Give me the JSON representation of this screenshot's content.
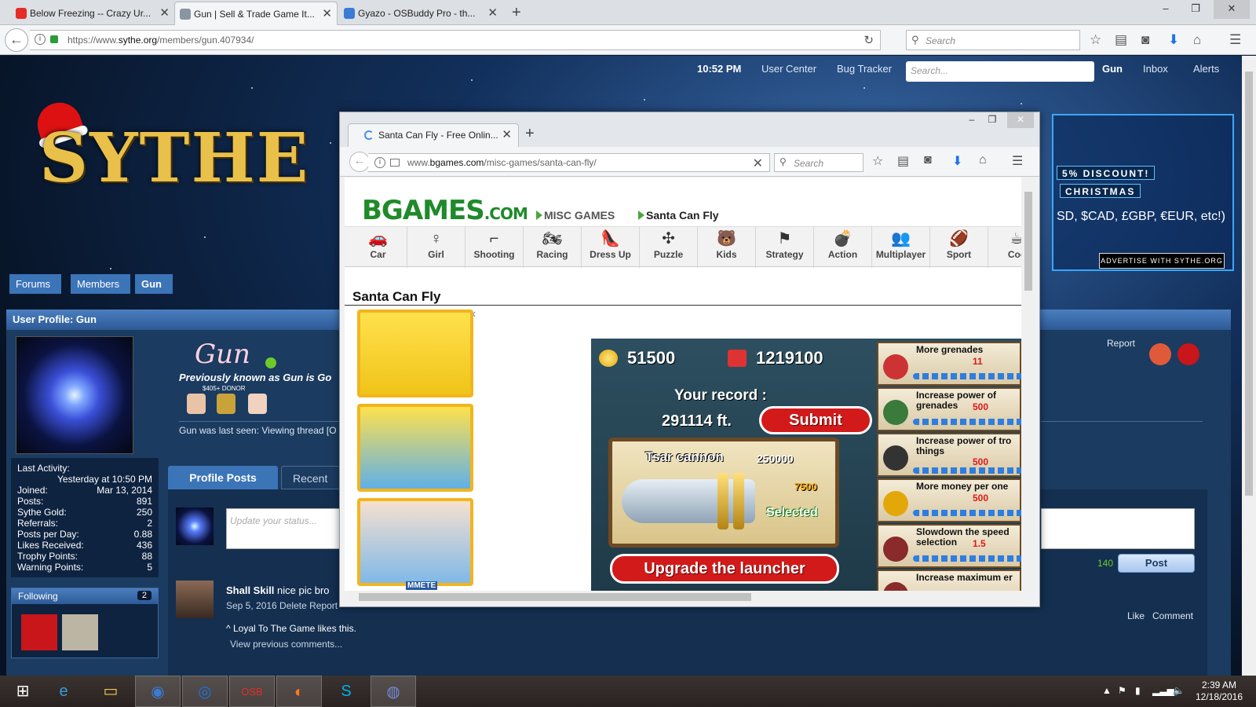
{
  "browser": {
    "tabs": [
      {
        "title": "Below Freezing -- Crazy Ur...",
        "favicon_color": "#e52d27"
      },
      {
        "title": "Gun | Sell & Trade Game It...",
        "favicon_color": "#8a95a3"
      },
      {
        "title": "Gyazo - OSBuddy Pro - th...",
        "favicon_color": "#3a7bd5"
      }
    ],
    "new_tab": "+",
    "url_prefix": "https://www.",
    "url_domain": "sythe.org",
    "url_path": "/members/gun.407934/",
    "search_placeholder": "Search",
    "win_min": "–",
    "win_max": "❐",
    "win_close": "✕"
  },
  "sythe": {
    "time": "10:52 PM",
    "nav": [
      "User Center",
      "Bug Tracker"
    ],
    "search_placeholder": "Search...",
    "user_nav": [
      "Gun",
      "Inbox",
      "Alerts"
    ],
    "logo": "SYTHE",
    "ad_tags": [
      "5% DISCOUNT!",
      "CHRISTMAS"
    ],
    "ad_currency": "SD, $CAD, £GBP, €EUR, etc!)",
    "advertise": "ADVERTISE WITH SYTHE.ORG",
    "breadcrumbs": [
      "Forums",
      "Members",
      "Gun"
    ],
    "profile_header": "User Profile: Gun",
    "username": "Gun",
    "user_title": "Previously known as Gun is Go",
    "donor_label": "$405+ DONOR",
    "last_seen": "Gun was last seen: Viewing thread [O",
    "stats": [
      {
        "label": "Last Activity:",
        "value": ""
      },
      {
        "label": "",
        "value": "Yesterday at 10:50 PM"
      },
      {
        "label": "Joined:",
        "value": "Mar 13, 2014"
      },
      {
        "label": "Posts:",
        "value": "891"
      },
      {
        "label": "Sythe Gold:",
        "value": "250"
      },
      {
        "label": "Referrals:",
        "value": "2"
      },
      {
        "label": "Posts per Day:",
        "value": "0.88"
      },
      {
        "label": "Likes Received:",
        "value": "436"
      },
      {
        "label": "Trophy Points:",
        "value": "88"
      },
      {
        "label": "Warning Points:",
        "value": "5"
      }
    ],
    "following_label": "Following",
    "following_count": "2",
    "tabs": [
      "Profile Posts",
      "Recent"
    ],
    "status_placeholder": "Update your status...",
    "char_count": "140",
    "post_button": "Post",
    "report": "Report",
    "post": {
      "author": "Shall Skill",
      "text": "nice pic bro",
      "meta": "Sep 5, 2016 Delete Report",
      "likes": "^ Loyal To The Game likes this.",
      "previous": "View previous comments...",
      "like": "Like",
      "comment": "Comment"
    }
  },
  "popup": {
    "tab_title": "Santa Can Fly - Free Onlin...",
    "url_prefix": "www.",
    "url_domain": "bgames.com",
    "url_path": "/misc-games/santa-can-fly/",
    "search_placeholder": "Search",
    "logo": "BGAMES",
    "logo_suffix": ".COM",
    "crumb_category": "MISC GAMES",
    "crumb_game": "Santa Can Fly",
    "categories": [
      {
        "label": "Car",
        "icon": "🚗"
      },
      {
        "label": "Girl",
        "icon": "♀"
      },
      {
        "label": "Shooting",
        "icon": "⌐"
      },
      {
        "label": "Racing",
        "icon": "🏍"
      },
      {
        "label": "Dress Up",
        "icon": "👠"
      },
      {
        "label": "Puzzle",
        "icon": "✣"
      },
      {
        "label": "Kids",
        "icon": "🐻"
      },
      {
        "label": "Strategy",
        "icon": "⚑"
      },
      {
        "label": "Action",
        "icon": "💣"
      },
      {
        "label": "Multiplayer",
        "icon": "👥"
      },
      {
        "label": "Sport",
        "icon": "🏈"
      },
      {
        "label": "Coo",
        "icon": "☕"
      }
    ],
    "game_title": "Santa Can Fly",
    "ad_caption": "MMETE",
    "game": {
      "coins": "51500",
      "gifts": "1219100",
      "record_label": "Your record :",
      "record": "291114 ft.",
      "submit": "Submit",
      "cannon_name": "Tsar cannon",
      "cannon_price": "250000",
      "cannon_damage": "7500",
      "cannon_status": "Selected",
      "upgrade": "Upgrade the launcher",
      "upgrades": [
        {
          "title": "More grenades",
          "value": "11"
        },
        {
          "title": "Increase power of grenades",
          "value": "500"
        },
        {
          "title": "Increase power of tro things",
          "value": "500"
        },
        {
          "title": "More money per one",
          "value": "500"
        },
        {
          "title": "Slowdown the speed selection",
          "value": "1.5"
        },
        {
          "title": "Increase maximum er",
          "value": ""
        }
      ]
    }
  },
  "taskbar": {
    "time": "2:39 AM",
    "date": "12/18/2016"
  }
}
